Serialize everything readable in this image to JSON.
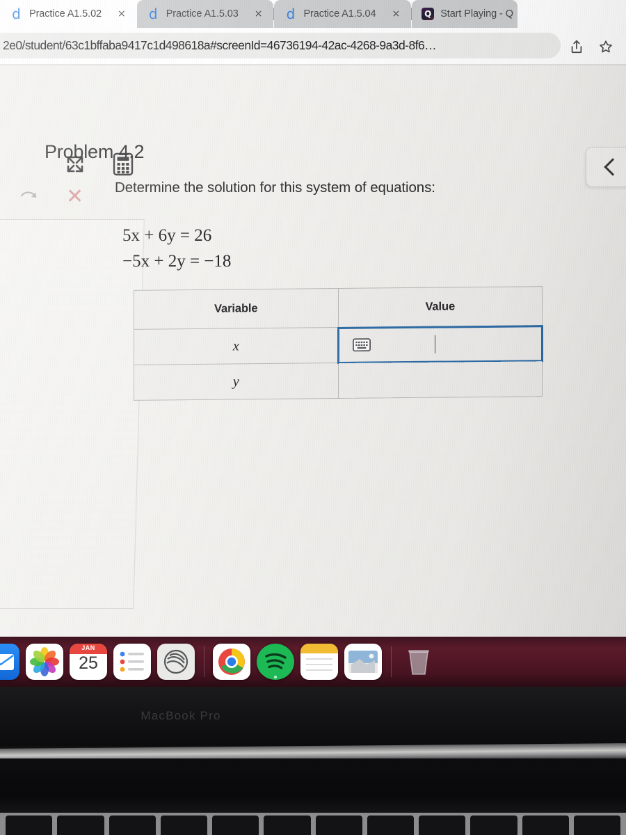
{
  "browser": {
    "tabs": [
      {
        "title": "Practice A1.5.02",
        "favicon": "desmos-d-icon",
        "active": true,
        "close_label": "×"
      },
      {
        "title": "Practice A1.5.03",
        "favicon": "desmos-d-icon",
        "active": false,
        "close_label": "×"
      },
      {
        "title": "Practice A1.5.04",
        "favicon": "desmos-d-icon",
        "active": false,
        "close_label": "×"
      },
      {
        "title": "Start Playing - Q",
        "favicon": "quizlet-q-icon",
        "active": false,
        "close_label": ""
      }
    ],
    "url": "2e0/student/63c1bffaba9417c1d498618a#screenId=46736194-42ac-4268-9a3d-8f6…",
    "share_icon": "share-icon",
    "bookmark_icon": "star-icon"
  },
  "toolbar": {
    "expand_icon": "expand-arrows-icon",
    "calculator_icon": "calculator-icon",
    "back_icon": "chevron-left-icon",
    "ghost_undo_icon": "undo-arrow-icon",
    "ghost_x_icon": "x-mark-icon",
    "ghost_x_glyph": "✕"
  },
  "problem": {
    "title": "Problem 4.2",
    "prompt": "Determine the solution for this system of equations:",
    "equations": [
      {
        "lhs": "5x + 6y",
        "rel": "=",
        "rhs": "26"
      },
      {
        "lhs": "−5x + 2y",
        "rel": "=",
        "rhs": "−18"
      }
    ],
    "equation_lines": [
      "5x + 6y = 26",
      "−5x + 2y = −18"
    ]
  },
  "table": {
    "headers": [
      "Variable",
      "Value"
    ],
    "rows": [
      {
        "variable": "x",
        "value": "",
        "focused": true
      },
      {
        "variable": "y",
        "value": "",
        "focused": false
      }
    ],
    "focused_cell_border_color": "#2d6ca8",
    "keyboard_icon": "keyboard-icon",
    "caret": "text-caret"
  },
  "dock": {
    "items": [
      {
        "name": "mail",
        "label": "Mail"
      },
      {
        "name": "photos",
        "label": "Photos"
      },
      {
        "name": "calendar",
        "label": "Calendar",
        "month": "JAN",
        "day": "25"
      },
      {
        "name": "reminders",
        "label": "Reminders"
      },
      {
        "name": "freeform",
        "label": "Freeform"
      },
      {
        "name": "chrome",
        "label": "Google Chrome"
      },
      {
        "name": "spotify",
        "label": "Spotify"
      },
      {
        "name": "notes",
        "label": "Notes"
      },
      {
        "name": "preview",
        "label": "Preview"
      },
      {
        "name": "trash",
        "label": "Trash"
      }
    ]
  },
  "device": {
    "bezel_label": "MacBook Pro"
  }
}
